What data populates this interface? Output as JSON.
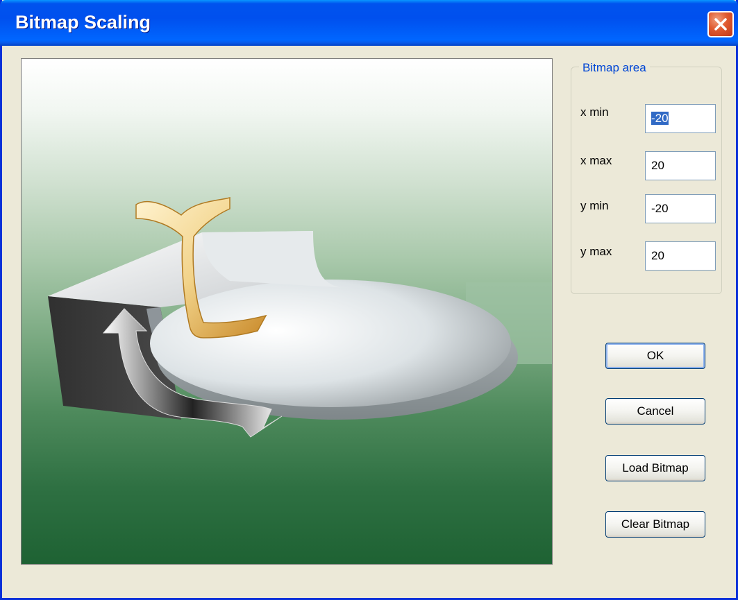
{
  "window": {
    "title": "Bitmap Scaling"
  },
  "bitmap_area": {
    "group_title": "Bitmap area",
    "fields": [
      {
        "label": "x min",
        "value": "-20",
        "selected": true
      },
      {
        "label": "x max",
        "value": "20"
      },
      {
        "label": "y min",
        "value": "-20"
      },
      {
        "label": "y max",
        "value": "20"
      }
    ]
  },
  "buttons": {
    "ok": "OK",
    "cancel": "Cancel",
    "load": "Load Bitmap",
    "clear": "Clear Bitmap"
  },
  "icons": {
    "close": "close-icon"
  },
  "colors": {
    "titlebar": "#0055E5",
    "dialog_bg": "#ECE9D8",
    "group_title": "#0046D5",
    "selection": "#316AC5"
  }
}
